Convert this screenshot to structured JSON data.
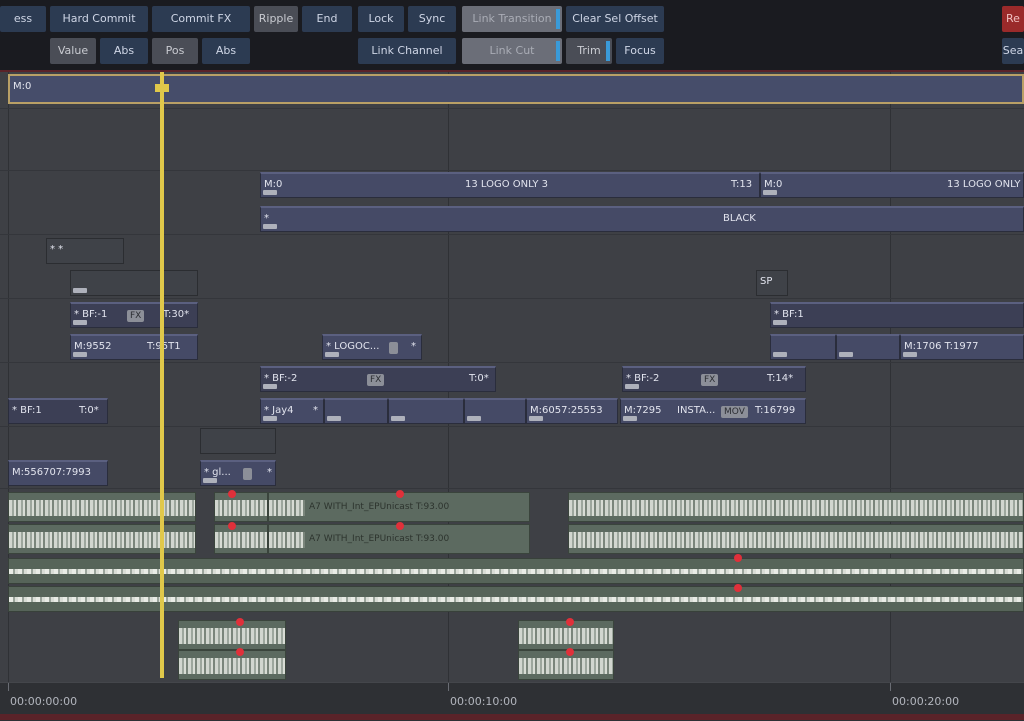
{
  "toolbar": {
    "row1": {
      "partial_left": "ess",
      "hard_commit": "Hard Commit",
      "commit_fx": "Commit FX",
      "ripple": "Ripple",
      "end": "End",
      "lock": "Lock",
      "sync": "Sync",
      "link_transition": "Link Transition",
      "clear_sel_offset": "Clear Sel Offset",
      "partial_right": "Re"
    },
    "row2": {
      "value": "Value",
      "abs1": "Abs",
      "pos": "Pos",
      "abs2": "Abs",
      "link_channel": "Link Channel",
      "link_cut": "Link Cut",
      "trim": "Trim",
      "focus": "Focus",
      "partial_right": "Sea"
    }
  },
  "timeline": {
    "master_clip": "M:0",
    "clips": {
      "logo1_m": "M:0",
      "logo1_name": "13 LOGO ONLY 3",
      "logo1_t": "T:13",
      "logo2_m": "M:0",
      "logo2_name": "13 LOGO ONLY",
      "black_star": "*",
      "black": "BLACK",
      "small1": "*          *",
      "bf1_name": "* BF:-1",
      "bf1_t": "T:30*",
      "bf1_badge": "FX",
      "m9552": "M:9552",
      "t9571": "T:95T1",
      "logoc": "* LOGOC...",
      "logoc_star": "*",
      "bf2_name": "* BF:-2",
      "bf2_t": "T:0*",
      "bf2_badge": "FX",
      "bf3_name": "* BF:-2",
      "bf3_t": "T:14*",
      "bf3_badge": "FX",
      "bf_left_name": "* BF:1",
      "bf_left_t": "T:0*",
      "jay": "* Jay4",
      "jay_star": "*",
      "m6057": "M:6057:25553",
      "m7295": "M:7295",
      "insta": "INSTA...",
      "insta_badge": "MOV",
      "t16799": "T:16799",
      "sp": "SP",
      "bf_r_name": "* BF:1",
      "m1706": "M:1706 T:1977",
      "m55": "M:556707:7993",
      "gl": "* gl...",
      "gl_star": "*"
    },
    "audio_label_1": "A7  WITH_Int_EPUnicast  T:93.00",
    "audio_label_2": "A7  WITH_Int_EPUnicast  T:93.00"
  },
  "ruler": {
    "t1": "00:00:00:00",
    "t2": "00:00:10:00",
    "t3": "00:00:20:00"
  },
  "colors": {
    "accent_blue": "#3a9ad8",
    "playhead": "#e0c84a",
    "keyframe_red": "#e0303a"
  }
}
